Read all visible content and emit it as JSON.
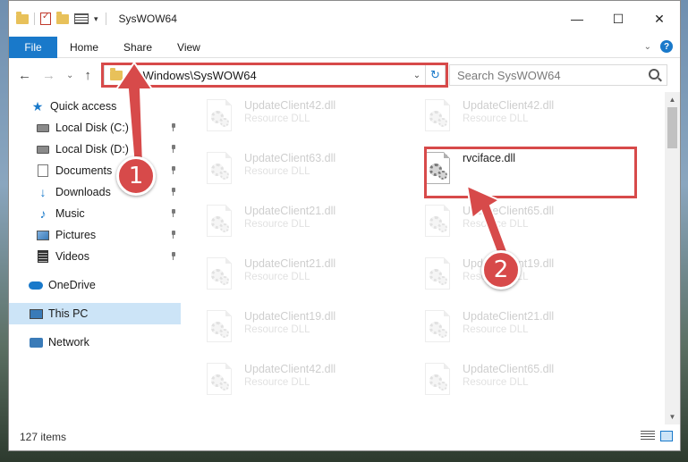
{
  "window": {
    "title": "SysWOW64",
    "controls": {
      "minimize": "—",
      "maximize": "☐",
      "close": "✕"
    }
  },
  "ribbon": {
    "file": "File",
    "tabs": [
      "Home",
      "Share",
      "View"
    ],
    "help": "?"
  },
  "address": {
    "path": "C:\\Windows\\SysWOW64",
    "search_placeholder": "Search SysWOW64"
  },
  "sidebar": {
    "quick_access": "Quick access",
    "quick_items": [
      {
        "label": "Local Disk (C:)",
        "icon": "disk-icon"
      },
      {
        "label": "Local Disk (D:)",
        "icon": "disk-icon"
      },
      {
        "label": "Documents",
        "icon": "documents-icon"
      },
      {
        "label": "Downloads",
        "icon": "downloads-icon"
      },
      {
        "label": "Music",
        "icon": "music-icon"
      },
      {
        "label": "Pictures",
        "icon": "pictures-icon"
      },
      {
        "label": "Videos",
        "icon": "videos-icon"
      }
    ],
    "onedrive": "OneDrive",
    "this_pc": "This PC",
    "network": "Network"
  },
  "files": [
    {
      "name": "UpdateClient42.dll",
      "type": "Resource DLL",
      "faded": true
    },
    {
      "name": "UpdateClient42.dll",
      "type": "Resource DLL",
      "faded": true
    },
    {
      "name": "UpdateClient63.dll",
      "type": "Resource DLL",
      "faded": true
    },
    {
      "name": "rvciface.dll",
      "type": "",
      "faded": false
    },
    {
      "name": "UpdateClient21.dll",
      "type": "Resource DLL",
      "faded": true
    },
    {
      "name": "UpdateClient65.dll",
      "type": "Resource DLL",
      "faded": true
    },
    {
      "name": "UpdateClient21.dll",
      "type": "Resource DLL",
      "faded": true
    },
    {
      "name": "UpdateClient19.dll",
      "type": "Resource DLL",
      "faded": true
    },
    {
      "name": "UpdateClient19.dll",
      "type": "Resource DLL",
      "faded": true
    },
    {
      "name": "UpdateClient21.dll",
      "type": "Resource DLL",
      "faded": true
    },
    {
      "name": "UpdateClient42.dll",
      "type": "Resource DLL",
      "faded": true
    },
    {
      "name": "UpdateClient65.dll",
      "type": "Resource DLL",
      "faded": true
    }
  ],
  "status": {
    "count": "127 items"
  },
  "annotations": {
    "step1": "1",
    "step2": "2",
    "color": "#d74a4a"
  }
}
